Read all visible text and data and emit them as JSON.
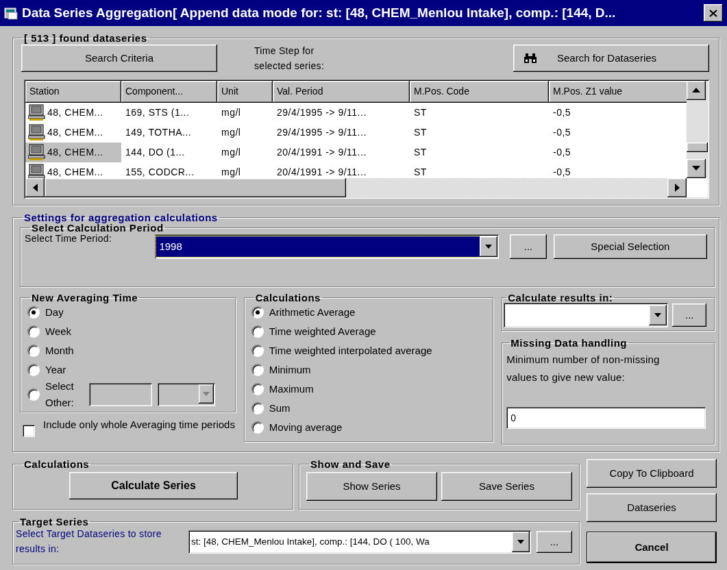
{
  "window": {
    "title": "Data Series Aggregation[ Append data mode for: st: [48, CHEM_Menlou Intake], comp.: [144, D..."
  },
  "found_panel": {
    "legend": "[ 513 ] found dataseries",
    "search_criteria_button": "Search Criteria",
    "time_step_label": "Time Step for selected series:",
    "search_button": "Search for Dataseries"
  },
  "table": {
    "columns": [
      "Station",
      "Component...",
      "Unit",
      "Val. Period",
      "M.Pos. Code",
      "M.Pos. Z1 value"
    ],
    "rows": [
      {
        "selected": false,
        "cells": [
          "48, CHEM...",
          "169, STS (1...",
          "mg/l",
          "29/4/1995 -> 9/11...",
          "ST",
          "-0,5"
        ]
      },
      {
        "selected": false,
        "cells": [
          "48, CHEM...",
          "149, TOTHA...",
          "mg/l",
          "29/4/1995 -> 9/11...",
          "ST",
          "-0,5"
        ]
      },
      {
        "selected": true,
        "cells": [
          "48, CHEM...",
          "144, DO (1...",
          "mg/l",
          "20/4/1991 -> 9/11...",
          "ST",
          "-0,5"
        ]
      },
      {
        "selected": false,
        "cells": [
          "48, CHEM...",
          "155, CODCR...",
          "mg/l",
          "20/4/1991 -> 9/11...",
          "ST",
          "-0,5"
        ]
      }
    ]
  },
  "settings": {
    "legend": "Settings for aggregation calculations",
    "period": {
      "legend": "Select Calculation Period",
      "label": "Select Time Period:",
      "value": "1998",
      "browse_button": "...",
      "special_button": "Special Selection"
    },
    "averaging": {
      "legend": "New Averaging Time",
      "options": [
        {
          "label": "Day",
          "selected": true,
          "kind": "plain"
        },
        {
          "label": "Week",
          "selected": false,
          "kind": "plain"
        },
        {
          "label": "Month",
          "selected": false,
          "kind": "plain"
        },
        {
          "label": "Year",
          "selected": false,
          "kind": "plain"
        },
        {
          "label": "Select Other:",
          "selected": false,
          "kind": "other"
        }
      ]
    },
    "whole_periods": {
      "label": "Include only whole Averaging time periods",
      "checked": false
    },
    "calculations": {
      "legend": "Calculations",
      "options": [
        {
          "label": "Arithmetic Average",
          "selected": true
        },
        {
          "label": "Time weighted Average",
          "selected": false
        },
        {
          "label": "Time weighted interpolated average",
          "selected": false
        },
        {
          "label": "Minimum",
          "selected": false
        },
        {
          "label": "Maximum",
          "selected": false
        },
        {
          "label": "Sum",
          "selected": false
        },
        {
          "label": "Moving average",
          "selected": false
        }
      ]
    },
    "results_in": {
      "legend": "Calculate results in:",
      "browse_button": "..."
    },
    "missing": {
      "legend": "Missing Data handling",
      "label": "Minimum number of non-missing values to give new value:",
      "value": "0"
    }
  },
  "calc_panel": {
    "legend": "Calculations",
    "button": "Calculate Series"
  },
  "show_save": {
    "legend": "Show and Save",
    "buttons": [
      "Show Series",
      "Save Series"
    ]
  },
  "side_buttons": [
    {
      "label": "Copy To Clipboard",
      "kind": "normal"
    },
    {
      "label": "Dataseries",
      "kind": "normal"
    },
    {
      "label": "Cancel",
      "kind": "default"
    }
  ],
  "target": {
    "legend": "Target Series",
    "label": "Select Target Dataseries to store results in:",
    "value": "st: [48, CHEM_Menlou Intake], comp.: [144, DO ( 100, Wa",
    "browse_button": "..."
  }
}
